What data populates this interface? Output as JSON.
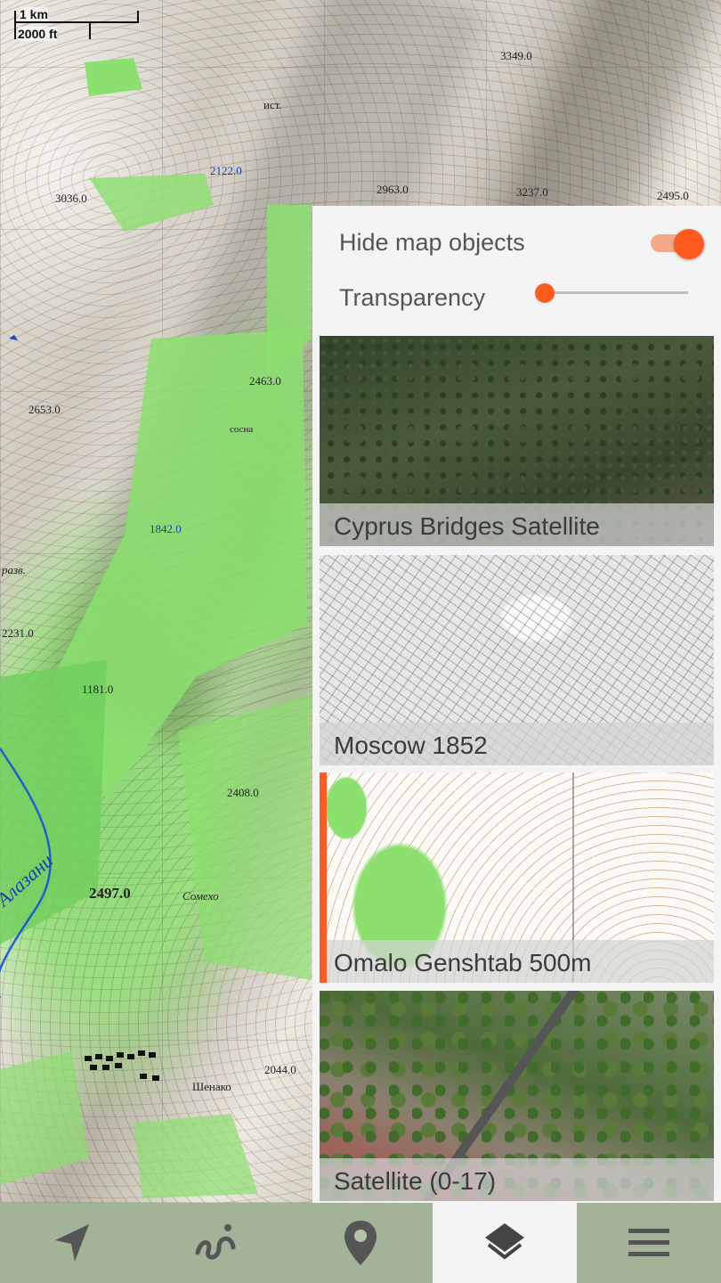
{
  "scale": {
    "top_label": "1 km",
    "bottom_label": "2000 ft"
  },
  "map_labels": [
    "3349.0",
    "2963.0",
    "3237.0",
    "2495.0",
    "3036.0",
    "2463.0",
    "2653.0",
    "2231.0",
    "1181.0",
    "2497.0",
    "Сомехо",
    "2408.0",
    "2044.0",
    "Шенако",
    "Алазани",
    "2122.0",
    "1842.0",
    "разв.",
    "сосна",
    "ист."
  ],
  "panel": {
    "hide_map_objects": {
      "label": "Hide map objects",
      "checked": true
    },
    "transparency": {
      "label": "Transparency",
      "value": 0
    }
  },
  "layers": [
    {
      "name": "Cyprus Bridges Satellite",
      "selected": false
    },
    {
      "name": "Moscow 1852",
      "selected": false
    },
    {
      "name": "Omalo Genshtab 500m",
      "selected": true
    },
    {
      "name": "Satellite (0-17)",
      "selected": false
    }
  ],
  "bottom_nav": [
    {
      "icon": "navigation-arrow-icon",
      "active": false
    },
    {
      "icon": "track-route-icon",
      "active": false
    },
    {
      "icon": "map-pin-icon",
      "active": false
    },
    {
      "icon": "layers-icon",
      "active": true
    },
    {
      "icon": "hamburger-menu-icon",
      "active": false
    }
  ],
  "colors": {
    "accent": "#ff5a1f",
    "panel_bg": "#f4f4f4",
    "forest_green": "#8be06e"
  }
}
